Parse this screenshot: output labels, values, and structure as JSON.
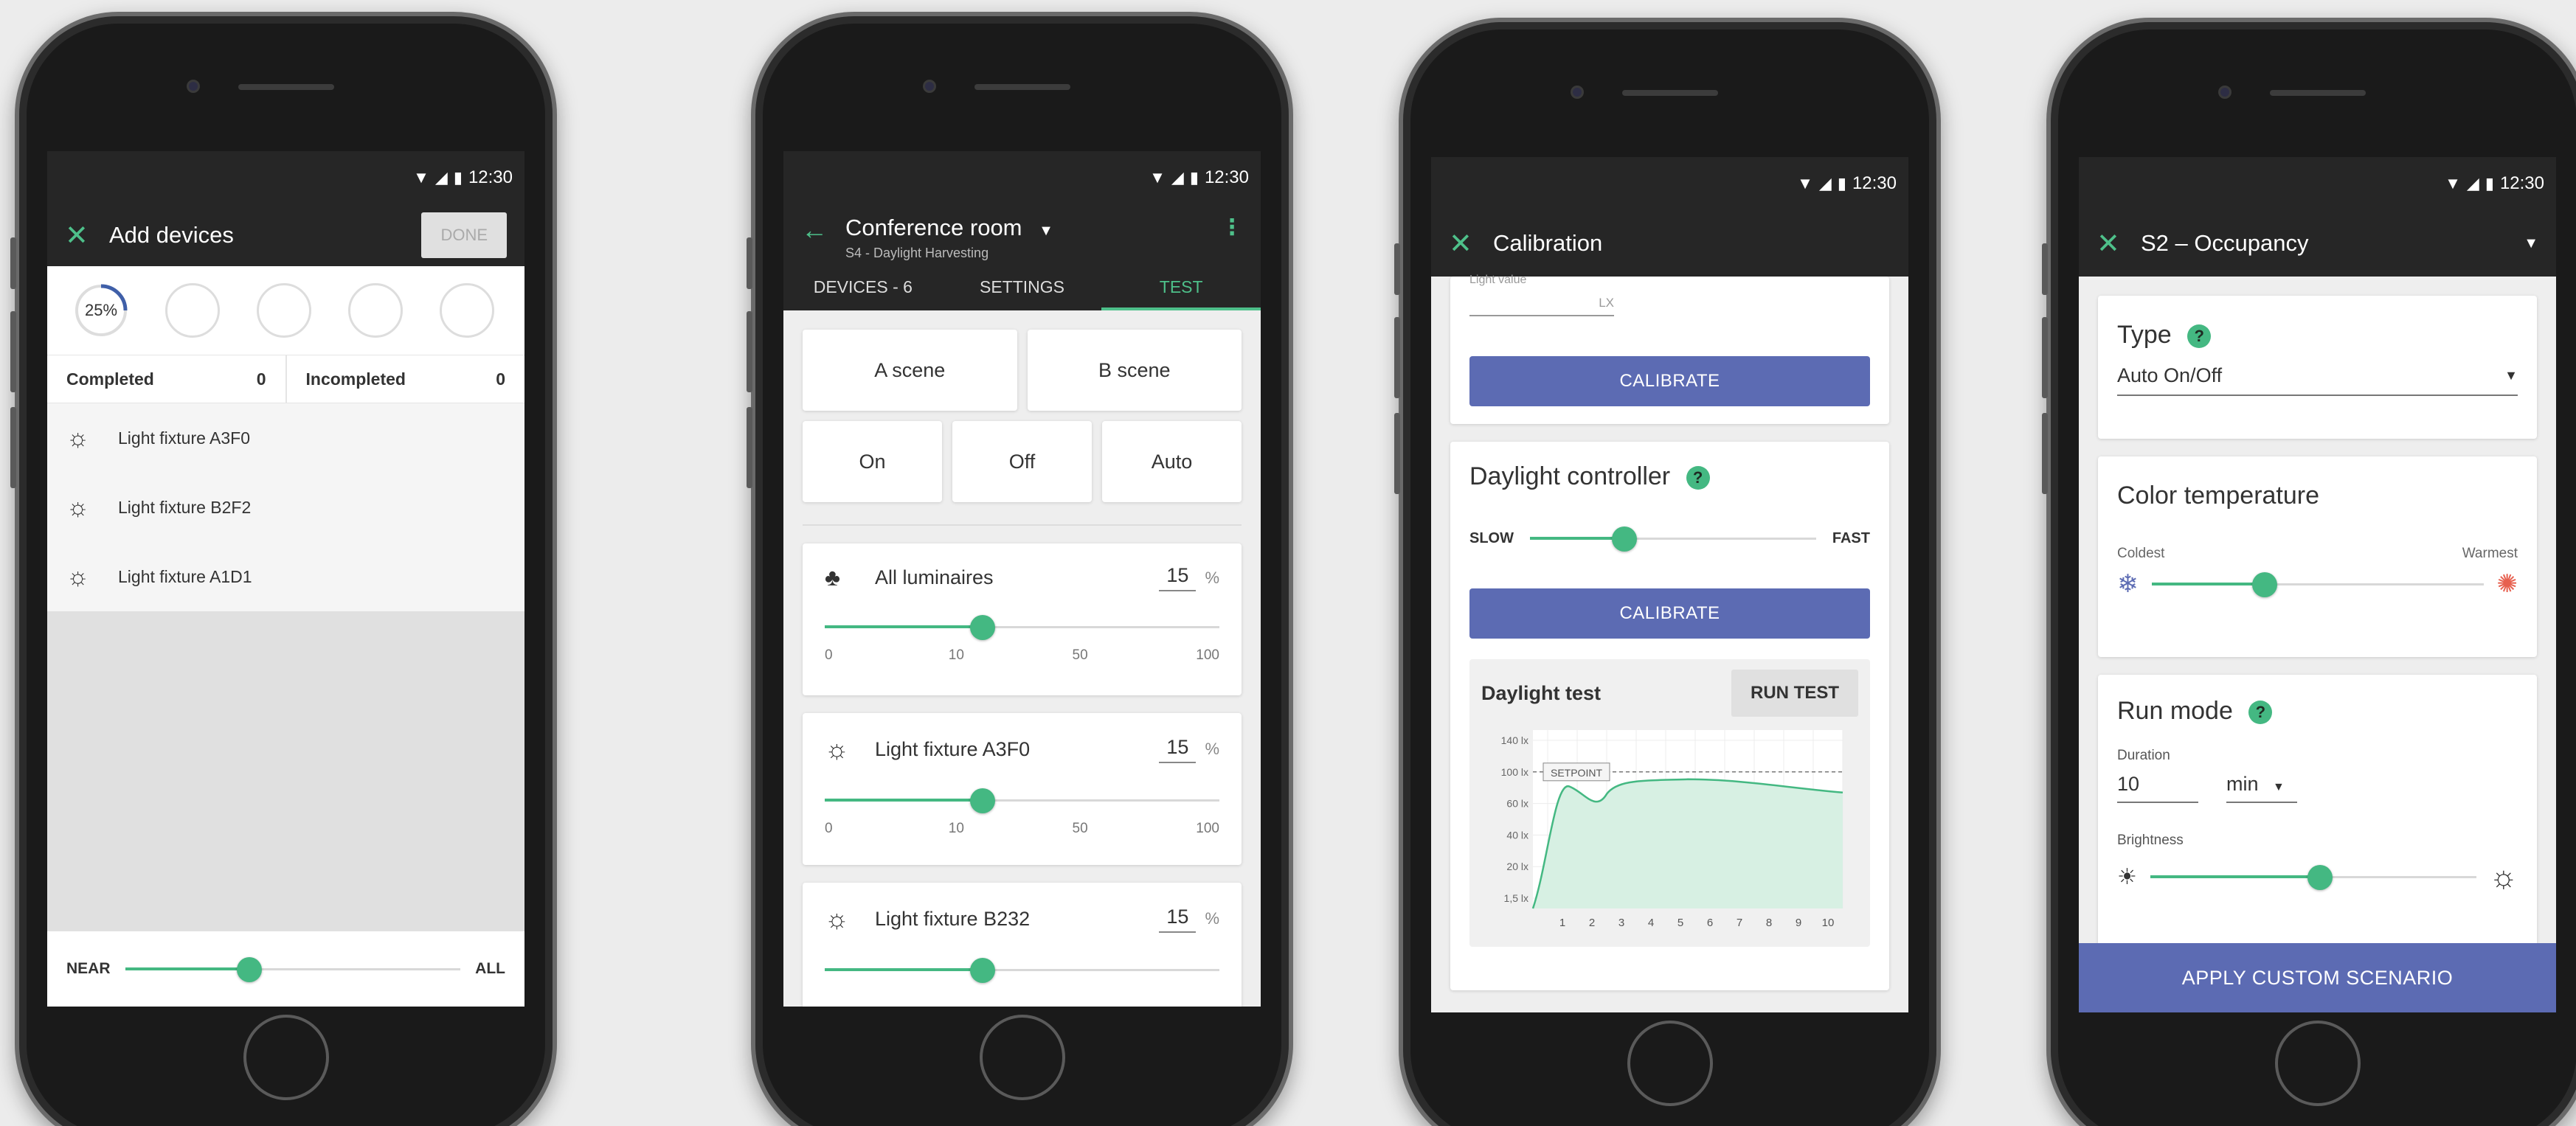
{
  "status": {
    "time": "12:30"
  },
  "colors": {
    "accent": "#44b882",
    "primary": "#5c6bb3",
    "appbar": "#262626"
  },
  "screen1": {
    "title": "Add devices",
    "done_label": "DONE",
    "progress_label": "25%",
    "progress": 0.25,
    "completed_label": "Completed",
    "completed_count": "0",
    "incompleted_label": "Incompleted",
    "incompleted_count": "0",
    "devices": [
      {
        "label": "Light fixture  A3F0",
        "icon": "bulb-icon"
      },
      {
        "label": "Light fixture  B2F2",
        "icon": "bulb-icon"
      },
      {
        "label": "Light fixture  A1D1",
        "icon": "bulb-icon"
      }
    ],
    "near_label": "NEAR",
    "all_label": "ALL",
    "range_slider": 0.37
  },
  "screen2": {
    "title": "Conference room",
    "subtitle": "S4 - Daylight Harvesting",
    "tabs": [
      "DEVICES - 6",
      "SETTINGS",
      "TEST"
    ],
    "active_tab": "TEST",
    "scene_a": "A scene",
    "scene_b": "B scene",
    "on_label": "On",
    "off_label": "Off",
    "auto_label": "Auto",
    "items": [
      {
        "label": "All luminaires",
        "value": "15",
        "unit": "%",
        "icon": "luminaires-icon",
        "ticks": [
          "0",
          "10",
          "50",
          "100"
        ],
        "level": 0.4
      },
      {
        "label": "Light fixture  A3F0",
        "value": "15",
        "unit": "%",
        "icon": "bulb-icon",
        "ticks": [
          "0",
          "10",
          "50",
          "100"
        ],
        "level": 0.4
      },
      {
        "label": "Light fixture  B232",
        "value": "15",
        "unit": "%",
        "icon": "bulb-icon",
        "level": 0.4
      }
    ]
  },
  "screen3": {
    "title": "Calibration",
    "light_value_label": "Light value",
    "lx_unit": "LX",
    "calibrate_label": "CALIBRATE",
    "daylight_controller_label": "Daylight controller",
    "slow_label": "SLOW",
    "fast_label": "FAST",
    "speed_level": 0.33,
    "daylight_test_label": "Daylight test",
    "run_test_label": "RUN TEST",
    "setpoint_label": "SETPOINT",
    "chart_data": {
      "type": "area",
      "x": [
        1,
        2,
        3,
        4,
        5,
        6,
        7,
        8,
        9,
        10
      ],
      "y_ticks": [
        "140 lx",
        "100 lx",
        "60 lx",
        "40 lx",
        "20 lx",
        "1,5 lx"
      ],
      "x_ticks": [
        "1",
        "2",
        "3",
        "4",
        "5",
        "6",
        "7",
        "8",
        "9",
        "10"
      ]
    }
  },
  "screen4": {
    "title": "S2 – Occupancy",
    "type_label": "Type",
    "type_value": "Auto On/Off",
    "color_temp_label": "Color temperature",
    "coldest_label": "Coldest",
    "warmest_label": "Warmest",
    "color_temp_level": 0.34,
    "run_mode_label": "Run mode",
    "duration_label": "Duration",
    "duration_value": "10",
    "duration_unit": "min",
    "brightness_label": "Brightness",
    "brightness_level": 0.52,
    "apply_label": "APPLY CUSTOM SCENARIO"
  }
}
